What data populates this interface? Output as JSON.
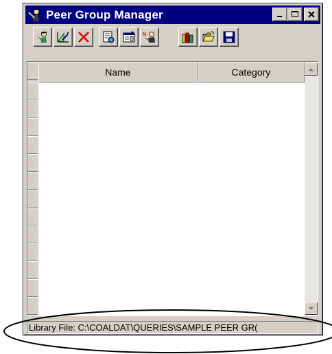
{
  "window": {
    "title": "Peer Group Manager"
  },
  "title_icon": "person-wizard-icon",
  "window_buttons": [
    "minimize-icon",
    "maximize-icon",
    "close-icon"
  ],
  "toolbar": {
    "buttons": [
      {
        "icon": "new-peer-group-wizard-icon"
      },
      {
        "icon": "edit-peer-group-icon"
      },
      {
        "icon": "delete-icon"
      },
      {
        "icon": "report-icon"
      },
      {
        "icon": "properties-icon"
      },
      {
        "icon": "peer-wizard-icon"
      },
      {
        "icon": "library-icon"
      },
      {
        "icon": "open-folder-icon"
      },
      {
        "icon": "save-icon"
      }
    ]
  },
  "grid": {
    "columns": [
      "Name",
      "Category"
    ],
    "rows": []
  },
  "status": {
    "library_file": "Library File: C:\\COALDAT\\QUERIES\\SAMPLE PEER GR("
  },
  "colors": {
    "title_bar": "#000080",
    "face": "#d4d0c8",
    "annotation": "#000000"
  }
}
